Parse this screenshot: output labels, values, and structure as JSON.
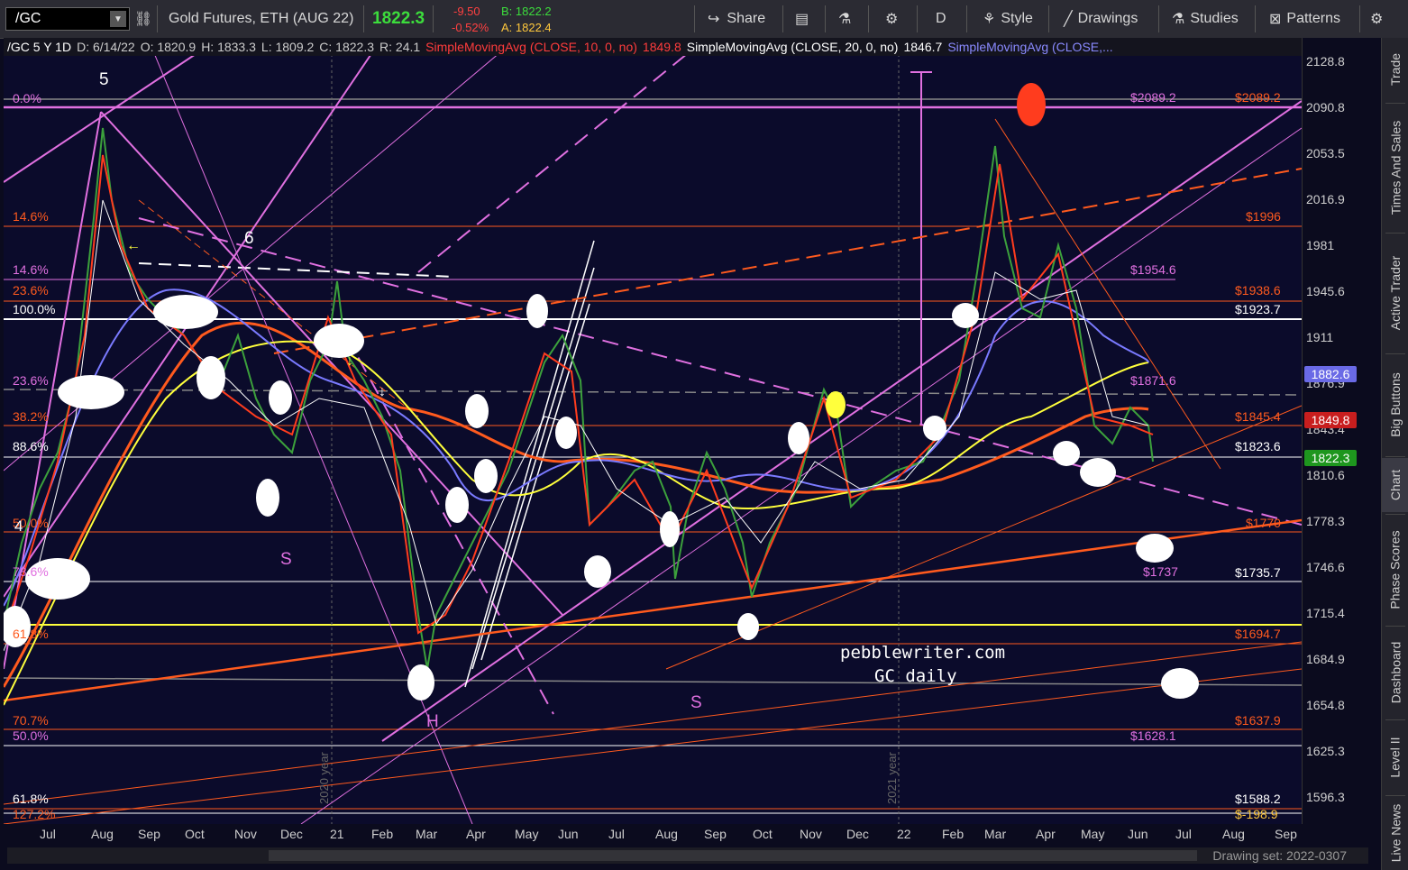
{
  "toolbar": {
    "symbol": "/GC",
    "instrument": "Gold Futures, ETH (AUG 22)",
    "last": "1822.3",
    "change": "-9.50",
    "change_pct": "-0.52%",
    "bid": "B: 1822.2",
    "ask": "A: 1822.4",
    "share": "Share",
    "interval": "D",
    "style": "Style",
    "drawings": "Drawings",
    "studies": "Studies",
    "patterns": "Patterns"
  },
  "info": {
    "symbol": "/GC 5 Y 1D",
    "date": "D: 6/14/22",
    "open": "O: 1820.9",
    "high": "H: 1833.3",
    "low": "L: 1809.2",
    "close": "C: 1822.3",
    "range": "R: 24.1",
    "sma10": "SimpleMovingAvg (CLOSE, 10, 0, no)",
    "sma10_val": "1849.8",
    "sma20": "SimpleMovingAvg (CLOSE, 20, 0, no)",
    "sma20_val": "1846.7",
    "sma3": "SimpleMovingAvg (CLOSE,..."
  },
  "price_axis": [
    "2128.8",
    "2090.8",
    "2053.5",
    "2016.9",
    "1981",
    "1945.6",
    "1911",
    "1876.9",
    "1843.4",
    "1810.6",
    "1778.3",
    "1746.6",
    "1715.4",
    "1684.9",
    "1654.8",
    "1625.3",
    "1596.3"
  ],
  "price_tags": {
    "blue": "1882.6",
    "red": "1849.8",
    "green": "1822.3"
  },
  "time_axis": [
    "Jul",
    "Aug",
    "Sep",
    "Oct",
    "Nov",
    "Dec",
    "21",
    "Feb",
    "Mar",
    "Apr",
    "May",
    "Jun",
    "Jul",
    "Aug",
    "Sep",
    "Oct",
    "Nov",
    "Dec",
    "22",
    "Feb",
    "Mar",
    "Apr",
    "May",
    "Jun",
    "Jul",
    "Aug",
    "Sep"
  ],
  "drawing_set": "Drawing set: 2022-0307",
  "sidebar": [
    "Trade",
    "Times And Sales",
    "Active Trader",
    "Big Buttons",
    "Chart",
    "Phase Scores",
    "Dashboard",
    "Level II",
    "Live News"
  ],
  "fib_left": {
    "f00": "0.0%",
    "f146a": "14.6%",
    "f146b": "14.6%",
    "f236a": "23.6%",
    "f100": "100.0%",
    "f236b": "23.6%",
    "f382": "38.2%",
    "f886": "88.6%",
    "f500a": "50.0%",
    "f786": "78.6%",
    "f618a": "61.8%",
    "f707": "70.7%",
    "f500b": "50.0%",
    "f618b": "61.8%",
    "f1272": "127.2%"
  },
  "levels_right": {
    "l2089a": "$2089.2",
    "l2089b": "$2089.2",
    "l1996": "$1996",
    "l1954": "$1954.6",
    "l1938": "$1938.6",
    "l1923": "$1923.7",
    "l1871": "$1871.6",
    "l1845": "$1845.4",
    "l1823": "$1823.6",
    "l1770": "$1770",
    "l1737": "$1737",
    "l1735": "$1735.7",
    "l1694": "$1694.7",
    "l1637": "$1637.9",
    "l1628": "$1628.1",
    "l1588": "$1588.2",
    "l198": "$-198.9"
  },
  "annotations": {
    "wave5": "5",
    "wave6": "6",
    "wave4": "4",
    "s1": "S",
    "h": "H",
    "s2": "S",
    "watermark1": "pebblewriter.com",
    "watermark2": "GC daily",
    "year2020": "2020 year",
    "year2021": "2021 year"
  },
  "colors": {
    "background": "#0b0b2b",
    "magenta": "#e070e0",
    "orange": "#ff5a1e",
    "yellow": "#ffff3c",
    "blue_ma": "#7a7aff",
    "white": "#ffffff"
  }
}
